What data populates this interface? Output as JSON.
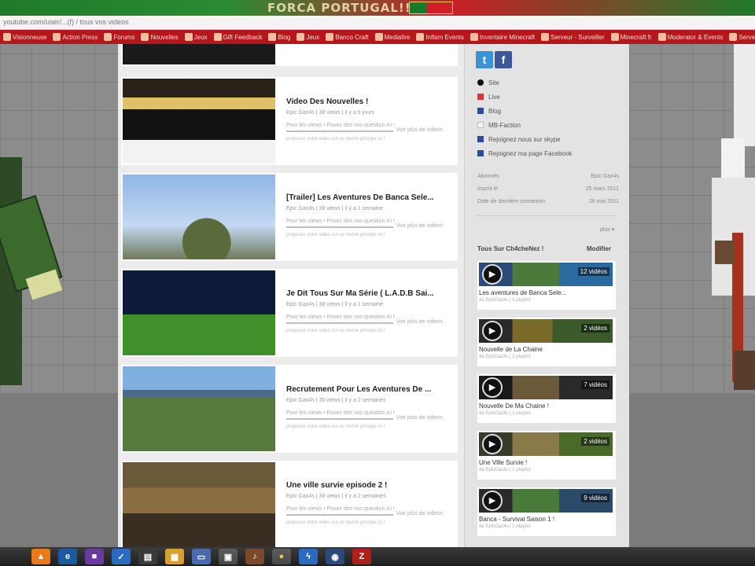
{
  "banner": {
    "text": "FORCA PORTUGAL!!"
  },
  "address_bar": {
    "url": "youtube.com/user/...(f) / tous vos videos"
  },
  "bookmarks": [
    "Visionneuse",
    "Action Press",
    "Forums",
    "Nouvelles",
    "Jeux",
    "Gift Feedback",
    "Blog",
    "Jeux",
    "Banco Craft",
    "Mediafire",
    "Inflam Events",
    "Inventaire Minecraft",
    "Serveur - Surveiller",
    "Minecraft fr",
    "Moderator & Events",
    "Serveurs minecraft"
  ],
  "videos": [
    {
      "title": "Video Des Nouvelles !",
      "meta": "Epic Gaz4s | 38 views | il y a 9 jours",
      "rate": "Pour les views • Posez des vos question ici !",
      "side": "Voir plus de videos",
      "tiny": "proposez votre video sur ce meme principe ici !"
    },
    {
      "title": "[Trailer] Les Aventures De Banca Sele...",
      "meta": "Epic Gaz4s | 38 views | il y a 1 semaine",
      "rate": "Pour les views • Posez des vos question ici !",
      "side": "Voir plus de videos",
      "tiny": "proposez votre video sur ce meme principe ici !"
    },
    {
      "title": "Je Dit Tous Sur Ma Série ( L.A.D.B Sai...",
      "meta": "Epic Gaz4s | 38 views | il y a 1 semaine",
      "rate": "Pour les views • Posez des vos question ici !",
      "side": "Voir plus de videos",
      "tiny": "proposez votre video sur ce meme principe ici !"
    },
    {
      "title": "Recrutement Pour Les Aventures De ...",
      "meta": "Epic Gaz4s | 35 views | il y a 2 semaines",
      "rate": "Pour les views • Posez des vos question ici !",
      "side": "Voir plus de videos",
      "tiny": "proposez votre video sur ce meme principe ici !"
    },
    {
      "title": "Une ville survie episode 2 !",
      "meta": "Epic Gaz4s | 38 views | il y a 2 semaines",
      "rate": "Pour les views • Posez des vos question ici !",
      "side": "Voir plus de videos",
      "tiny": "proposez votre video sur ce meme principe ici !"
    }
  ],
  "sidebar": {
    "links": [
      "Site",
      "Live",
      "Blog",
      "MB-Faction",
      "Rejoignez nous sur skype",
      "Rejoignez ma page Facebook"
    ],
    "stats": [
      {
        "label": "Abonnés",
        "value": "Epic Gaz4s"
      },
      {
        "label": "Inscrit le",
        "value": "25 mars 2011"
      },
      {
        "label": "Date de dernière connexion",
        "value": "26 mai 2011"
      }
    ],
    "more": "plus ▾",
    "playlist_title": "Tous Sur Ch4cheNez !",
    "playlist_action": "Modifier",
    "playlists": [
      {
        "title": "Les aventures de Banca Sele...",
        "sub": "de EpicGaz4s | 1 playlist",
        "badge": "12 vidéos"
      },
      {
        "title": "Nouvelle de La Chaine",
        "sub": "de EpicGaz4s | 1 playlist",
        "badge": "2 vidéos"
      },
      {
        "title": "Nouvelle De Ma Chaine !",
        "sub": "de EpicGaz4s | 1 playlist",
        "badge": "7 vidéos"
      },
      {
        "title": "Une Ville Survie !",
        "sub": "de EpicGaz4s | 1 playlist",
        "badge": "2 vidéos"
      },
      {
        "title": "Banca - Survival Saison 1 !",
        "sub": "de EpicGaz4s | 1 playlist",
        "badge": "9 vidéos"
      }
    ]
  },
  "taskbar": {
    "icons": [
      "vlc-icon",
      "ie-icon",
      "app-icon",
      "check-icon",
      "paint-icon",
      "picture-icon",
      "monitor-icon",
      "minecraft-icon",
      "note-icon",
      "chrome-icon",
      "thunder-icon",
      "network-icon",
      "filezilla-icon"
    ]
  }
}
